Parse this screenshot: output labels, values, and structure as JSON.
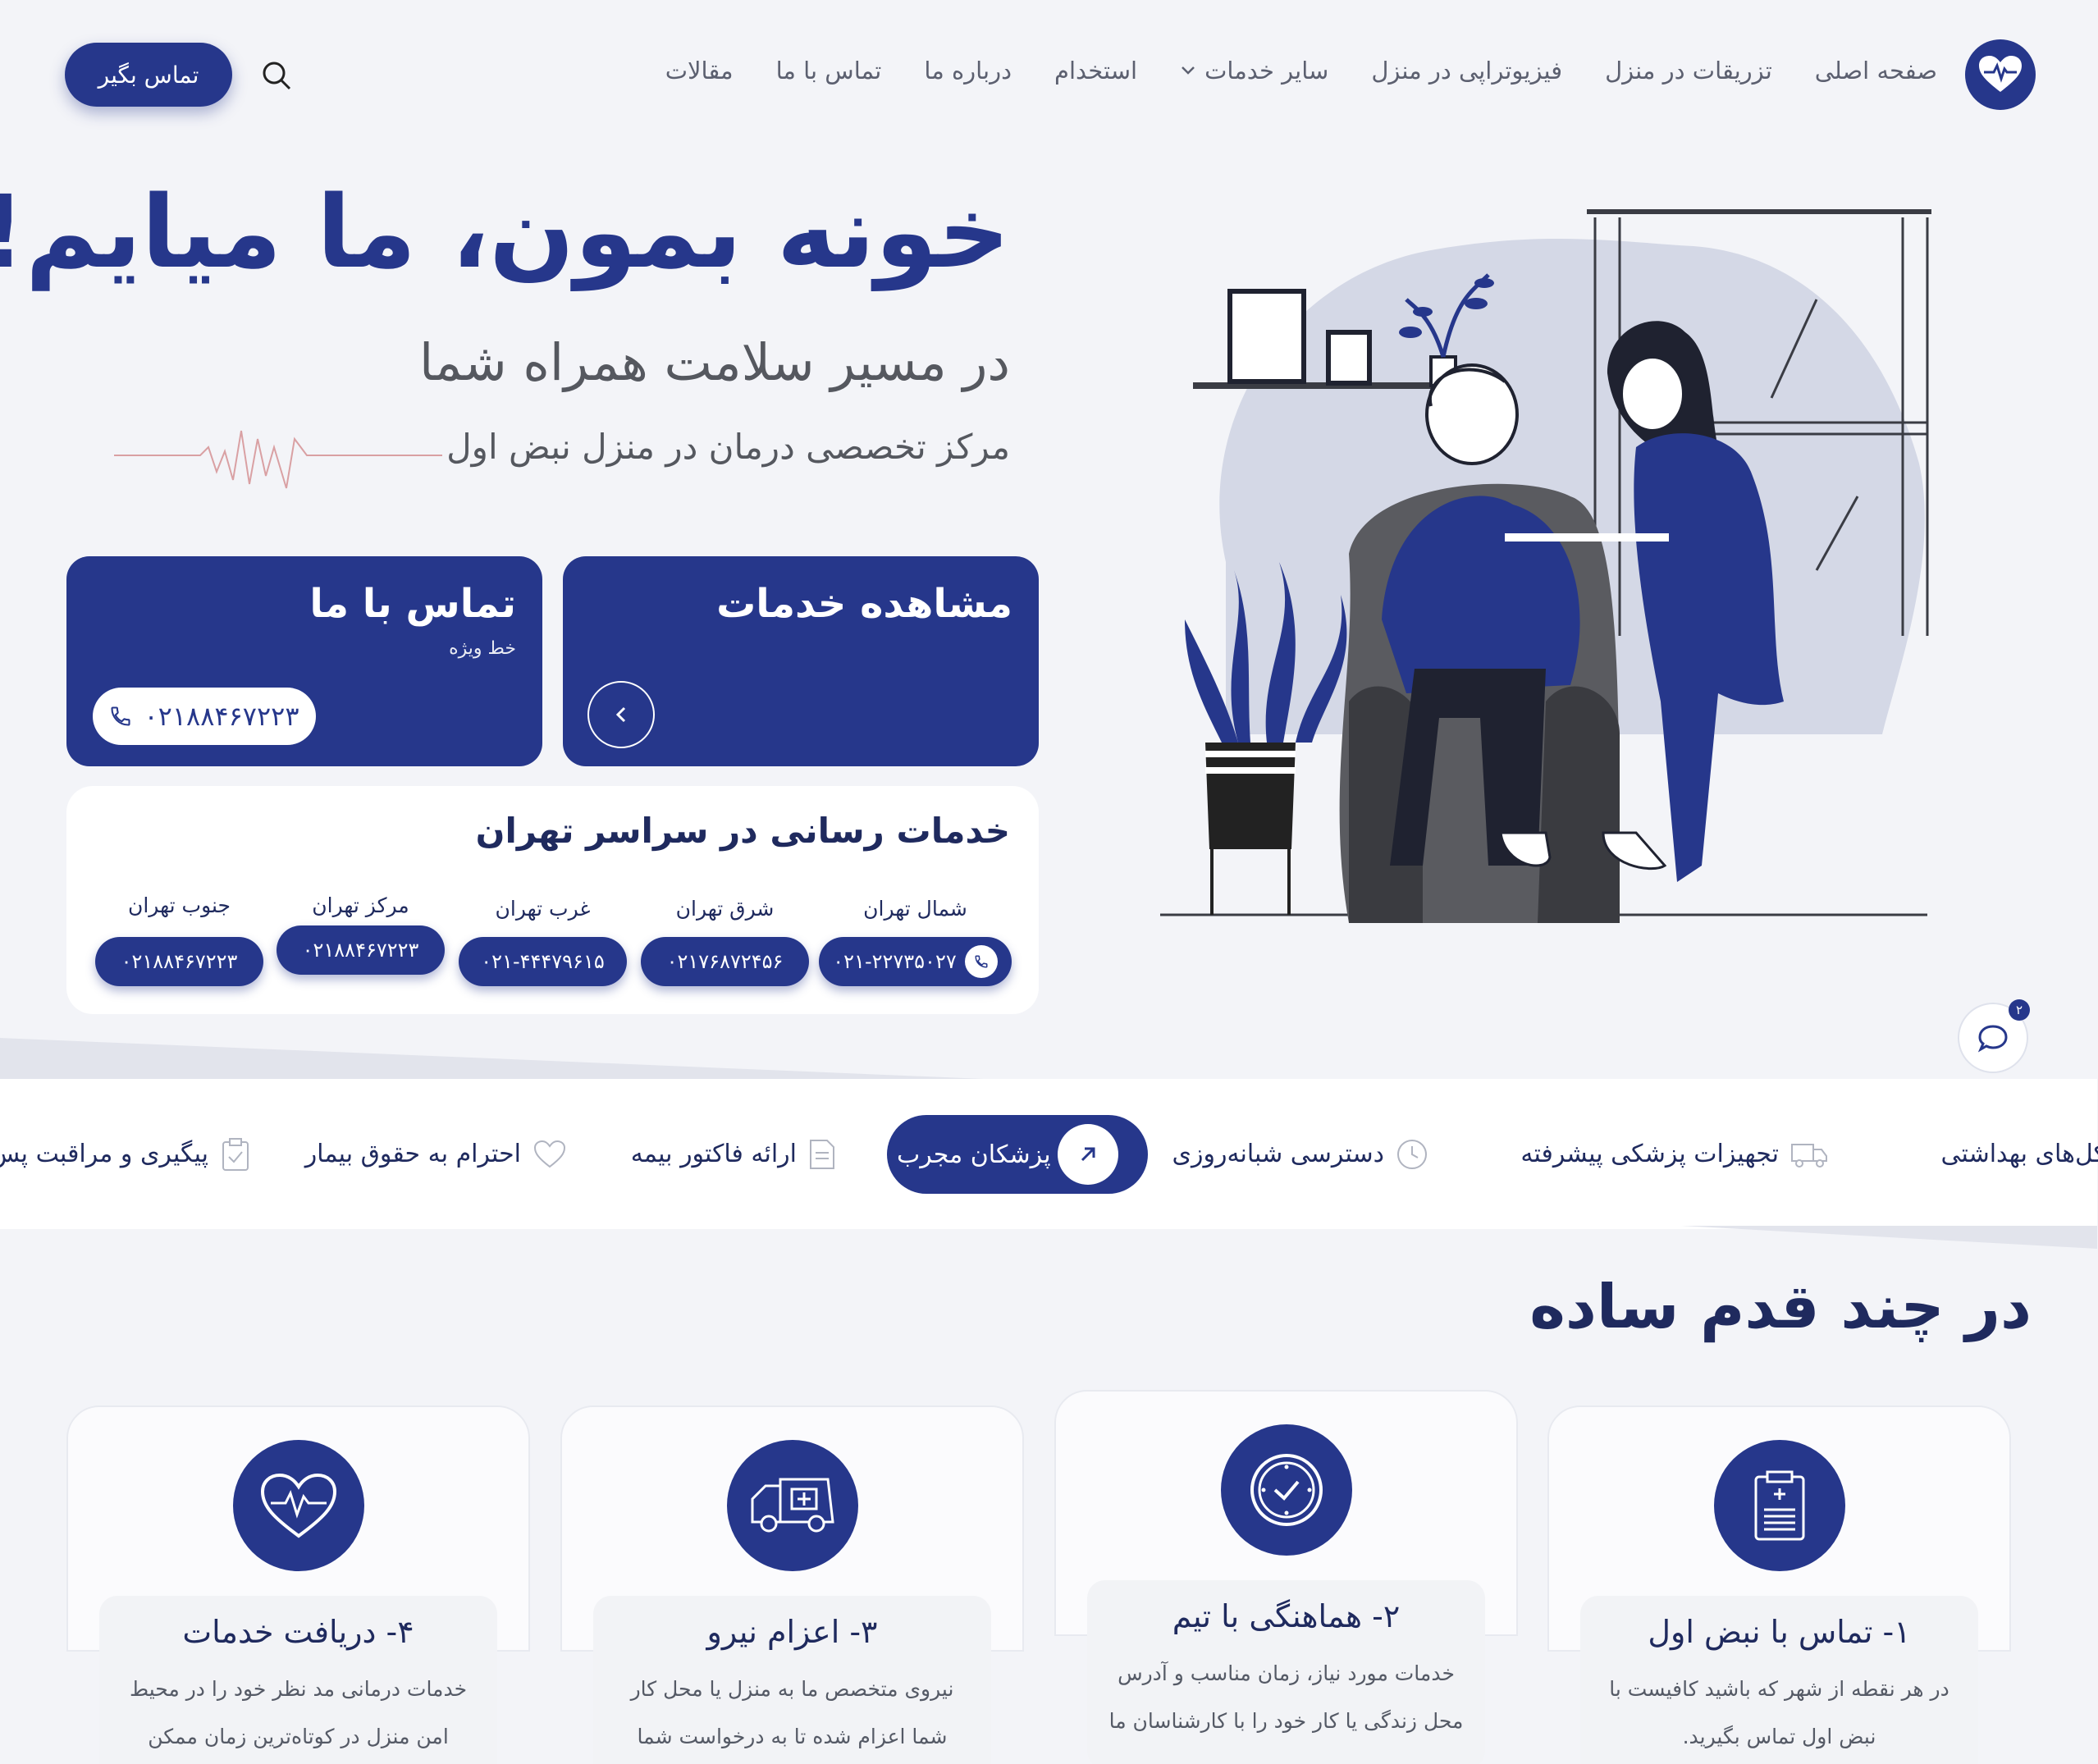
{
  "nav": {
    "items": [
      "صفحه اصلی",
      "تزریقات در منزل",
      "فیزیوتراپی در منزل",
      "سایر خدمات",
      "استخدام",
      "درباره ما",
      "تماس با ما",
      "مقالات"
    ],
    "cta": "تماس بگیر"
  },
  "hero": {
    "title": "خونه بمون، ما میایم!",
    "subtitle": "در مسیر سلامت همراه شما",
    "tagline": "مرکز تخصصی درمان در منزل نبض اول"
  },
  "cards": {
    "services_title": "مشاهده خدمات",
    "contact_title": "تماس با ما",
    "contact_sub": "خط ویژه",
    "contact_phone": "۰۲۱۸۸۴۶۷۲۲۳"
  },
  "tehran": {
    "title": "خدمات رسانی در سراسر تهران",
    "regions": [
      {
        "label": "شمال تهران",
        "phone": "۰۲۱-۲۲۷۳۵۰۲۷"
      },
      {
        "label": "شرق تهران",
        "phone": "۰۲۱۷۶۸۷۲۴۵۶"
      },
      {
        "label": "غرب تهران",
        "phone": "۰۲۱-۴۴۴۷۹۶۱۵"
      },
      {
        "label": "مرکز تهران",
        "phone": "۰۲۱۸۸۴۶۷۲۲۳"
      },
      {
        "label": "جنوب تهران",
        "phone": "۰۲۱۸۸۴۶۷۲۲۳"
      }
    ]
  },
  "chat": {
    "badge": "۲"
  },
  "features": {
    "items": [
      "پروتکل‌های بهداشتی",
      "تجهیزات پزشکی پیشرفته",
      "دسترسی شبانه‌روزی",
      "پزشکان مجرب",
      "ارائه فاکتور بیمه",
      "احترام به حقوق بیمار",
      "پیگیری و مراقبت پس"
    ]
  },
  "steps": {
    "title": "در چند قدم ساده",
    "items": [
      {
        "title": "۱- تماس با نبض اول",
        "desc1": "در هر نقطه از شهر که باشید کافیست با",
        "desc2": "نبض اول تماس بگیرید."
      },
      {
        "title": "۲- هماهنگی با تیم",
        "desc1": "خدمات مورد نیاز، زمان مناسب و آدرس",
        "desc2": "محل زندگی یا کار خود را با کارشناسان ما"
      },
      {
        "title": "۳- اعزام نیرو",
        "desc1": "نیروی متخصص ما به منزل یا محل کار",
        "desc2": "شما اعزام شده تا به درخواست شما"
      },
      {
        "title": "۴- دریافت خدمات",
        "desc1": "خدمات درمانی مد نظر خود را در محیط",
        "desc2": "امن منزل در کوتاه‌ترین زمان ممکن"
      }
    ]
  },
  "colors": {
    "primary": "#26378b",
    "background": "#f3f4f8",
    "text_dark": "#1f2a5e",
    "text_gray": "#5c6070"
  }
}
